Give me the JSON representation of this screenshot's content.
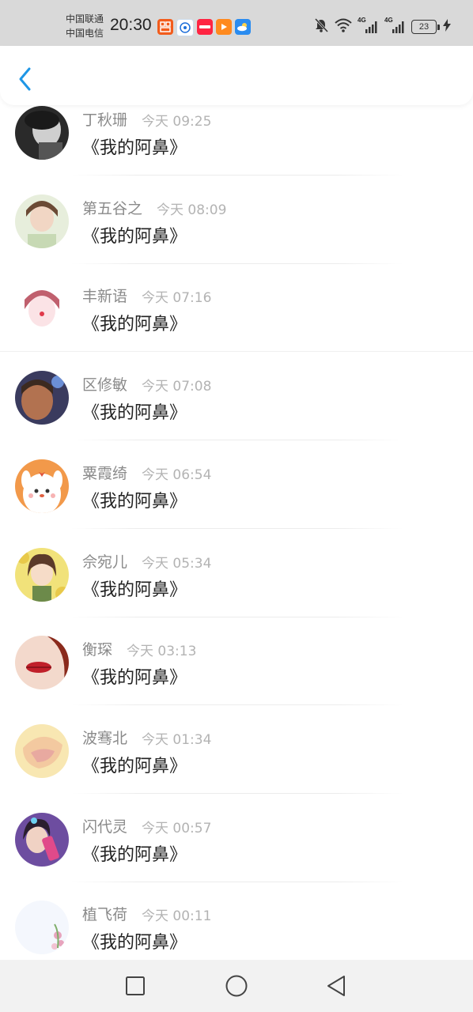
{
  "status_bar": {
    "carrier_1": "中国联通",
    "carrier_2": "中国电信",
    "time": "20:30",
    "battery": "23",
    "network_1": "4G",
    "network_2": "4G",
    "app_icons": [
      "taobao-icon",
      "iflytek-icon",
      "xiaohongshu-icon",
      "video-icon",
      "weather-icon"
    ]
  },
  "header": {
    "back_icon": "chevron-left-icon",
    "accent_color": "#1e96e6"
  },
  "messages": [
    {
      "name": "丁秋珊",
      "time": "今天 09:25",
      "text": "《我的阿鼻》",
      "avatar_colors": [
        "#cfcfcf",
        "#2a2a2a"
      ]
    },
    {
      "name": "第五谷之",
      "time": "今天 08:09",
      "text": "《我的阿鼻》",
      "avatar_colors": [
        "#e7eedc",
        "#7f8f6b"
      ]
    },
    {
      "name": "丰新语",
      "time": "今天 07:16",
      "text": "《我的阿鼻》",
      "avatar_colors": [
        "#fbe3e6",
        "#c0606e"
      ]
    },
    {
      "name": "区修敏",
      "time": "今天 07:08",
      "text": "《我的阿鼻》",
      "avatar_colors": [
        "#b27250",
        "#3a3b5e"
      ]
    },
    {
      "name": "粟霞绮",
      "time": "今天 06:54",
      "text": "《我的阿鼻》",
      "avatar_colors": [
        "#ffffff",
        "#f2994a"
      ]
    },
    {
      "name": "佘宛儿",
      "time": "今天 05:34",
      "text": "《我的阿鼻》",
      "avatar_colors": [
        "#f1e27a",
        "#5b3a2a"
      ]
    },
    {
      "name": "衡琛",
      "time": "今天 03:13",
      "text": "《我的阿鼻》",
      "avatar_colors": [
        "#f3d9cc",
        "#8a2a1c"
      ]
    },
    {
      "name": "波骞北",
      "time": "今天 01:34",
      "text": "《我的阿鼻》",
      "avatar_colors": [
        "#f8e7b2",
        "#e8a9a0"
      ]
    },
    {
      "name": "闪代灵",
      "time": "今天 00:57",
      "text": "《我的阿鼻》",
      "avatar_colors": [
        "#6d4da0",
        "#e04a8a"
      ]
    },
    {
      "name": "植飞荷",
      "time": "今天 00:11",
      "text": "《我的阿鼻》",
      "avatar_colors": [
        "#f4f7fd",
        "#e7a4bd"
      ]
    }
  ],
  "nav_bar": {
    "recent_icon": "square-icon",
    "home_icon": "circle-icon",
    "back_icon": "triangle-back-icon"
  }
}
